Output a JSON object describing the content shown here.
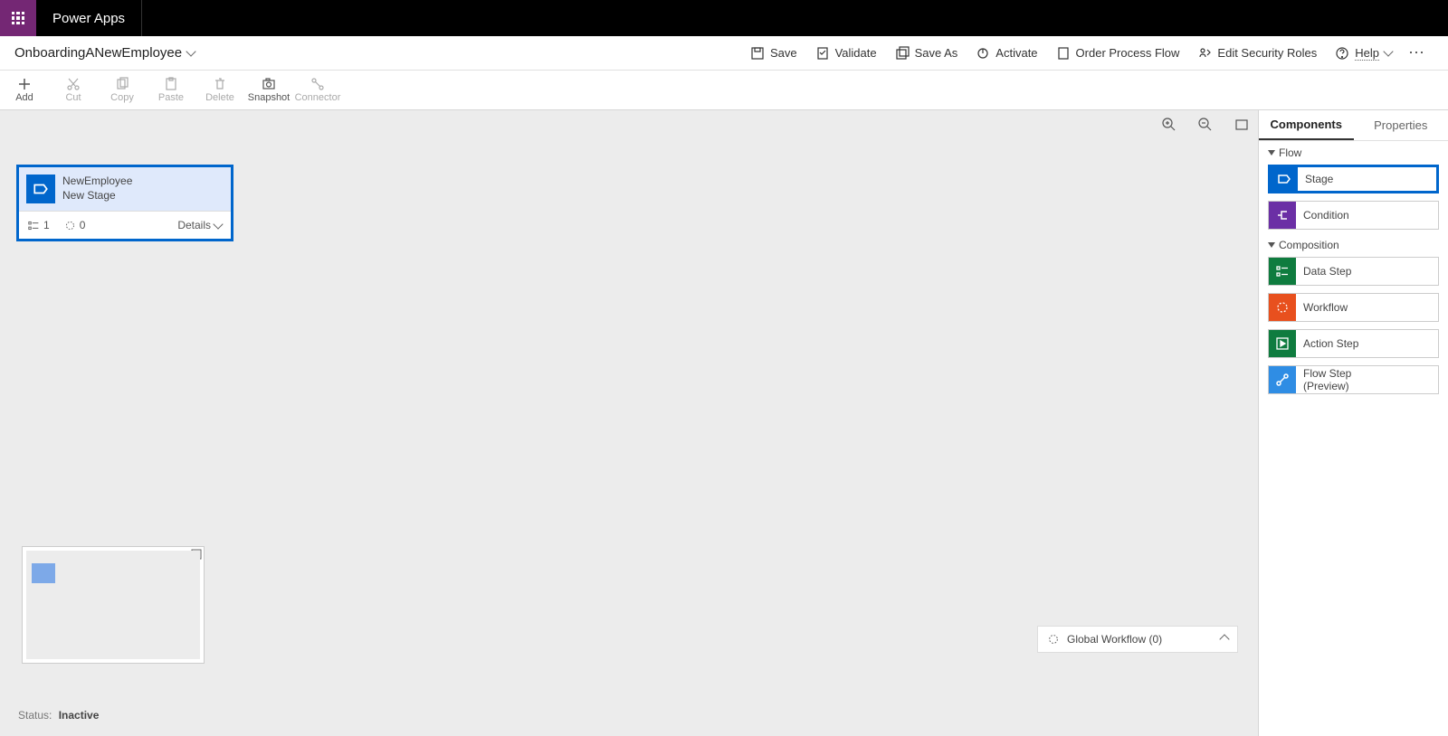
{
  "titlebar": {
    "app_name": "Power Apps"
  },
  "actionbar": {
    "flow_name": "OnboardingANewEmployee",
    "buttons": {
      "save": "Save",
      "validate": "Validate",
      "saveas": "Save As",
      "activate": "Activate",
      "order": "Order Process Flow",
      "editsec": "Edit Security Roles",
      "help": "Help"
    }
  },
  "toolbar": {
    "add": "Add",
    "cut": "Cut",
    "copy": "Copy",
    "paste": "Paste",
    "delete": "Delete",
    "snapshot": "Snapshot",
    "connector": "Connector"
  },
  "stage": {
    "entity": "NewEmployee",
    "name": "New Stage",
    "steps_count": "1",
    "wf_count": "0",
    "details_label": "Details"
  },
  "global_workflow": {
    "label": "Global Workflow (0)"
  },
  "status": {
    "label": "Status:",
    "value": "Inactive"
  },
  "right_panel": {
    "tabs": {
      "components": "Components",
      "properties": "Properties"
    },
    "sections": {
      "flow": "Flow",
      "composition": "Composition"
    },
    "components": {
      "stage": "Stage",
      "condition": "Condition",
      "datastep": "Data Step",
      "workflow": "Workflow",
      "actionstep": "Action Step",
      "flowstep": "Flow Step\n(Preview)"
    }
  }
}
